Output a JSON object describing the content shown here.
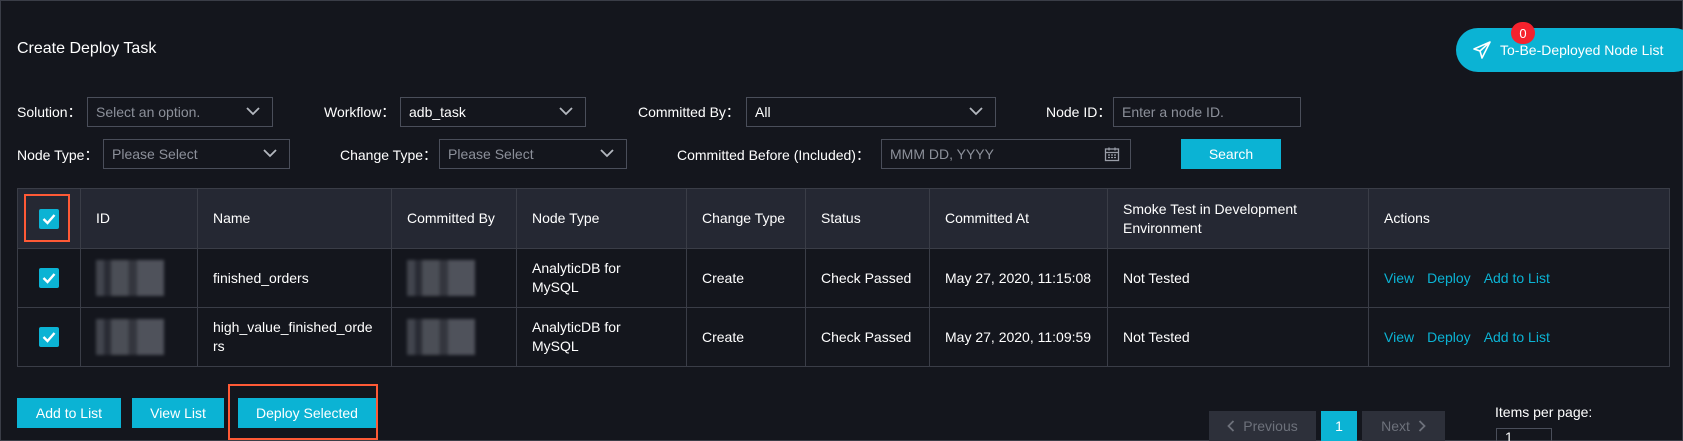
{
  "page": {
    "title": "Create Deploy Task"
  },
  "deploy_list": {
    "label": "To-Be-Deployed Node List",
    "badge": "0"
  },
  "filters": {
    "solution": {
      "label": "Solution：",
      "placeholder": "Select an option."
    },
    "workflow": {
      "label": "Workflow：",
      "value": "adb_task"
    },
    "committed_by": {
      "label": "Committed By：",
      "value": "All"
    },
    "node_id": {
      "label": "Node ID：",
      "placeholder": "Enter a node ID."
    },
    "node_type": {
      "label": "Node Type：",
      "placeholder": "Please Select"
    },
    "change_type": {
      "label": "Change Type：",
      "placeholder": "Please Select"
    },
    "committed_before": {
      "label": "Committed Before (Included)：",
      "placeholder": "MMM DD, YYYY"
    },
    "search_label": "Search"
  },
  "table": {
    "columns": [
      "ID",
      "Name",
      "Committed By",
      "Node Type",
      "Change Type",
      "Status",
      "Committed At",
      "Smoke Test in Development Environment",
      "Actions"
    ],
    "rows": [
      {
        "name": "finished_orders",
        "node_type": "AnalyticDB for MySQL",
        "change_type": "Create",
        "status": "Check Passed",
        "committed_at": "May 27, 2020, 11:15:08",
        "smoke_test": "Not Tested",
        "checked": true
      },
      {
        "name": "high_value_finished_orders",
        "node_type": "AnalyticDB for MySQL",
        "change_type": "Create",
        "status": "Check Passed",
        "committed_at": "May 27, 2020, 11:09:59",
        "smoke_test": "Not Tested",
        "checked": true
      }
    ],
    "actions": {
      "view": "View",
      "deploy": "Deploy",
      "add": "Add to List"
    }
  },
  "bottom": {
    "add_to_list": "Add to List",
    "view_list": "View List",
    "deploy_selected": "Deploy Selected"
  },
  "pagination": {
    "previous": "Previous",
    "next": "Next",
    "current_page": "1",
    "items_per_page_label": "Items per page:",
    "items_per_page_value": "1"
  },
  "colors": {
    "accent": "#0bb3d4",
    "highlight": "#ff5a36",
    "success": "#4fcb4f",
    "badge": "#f5222d"
  }
}
